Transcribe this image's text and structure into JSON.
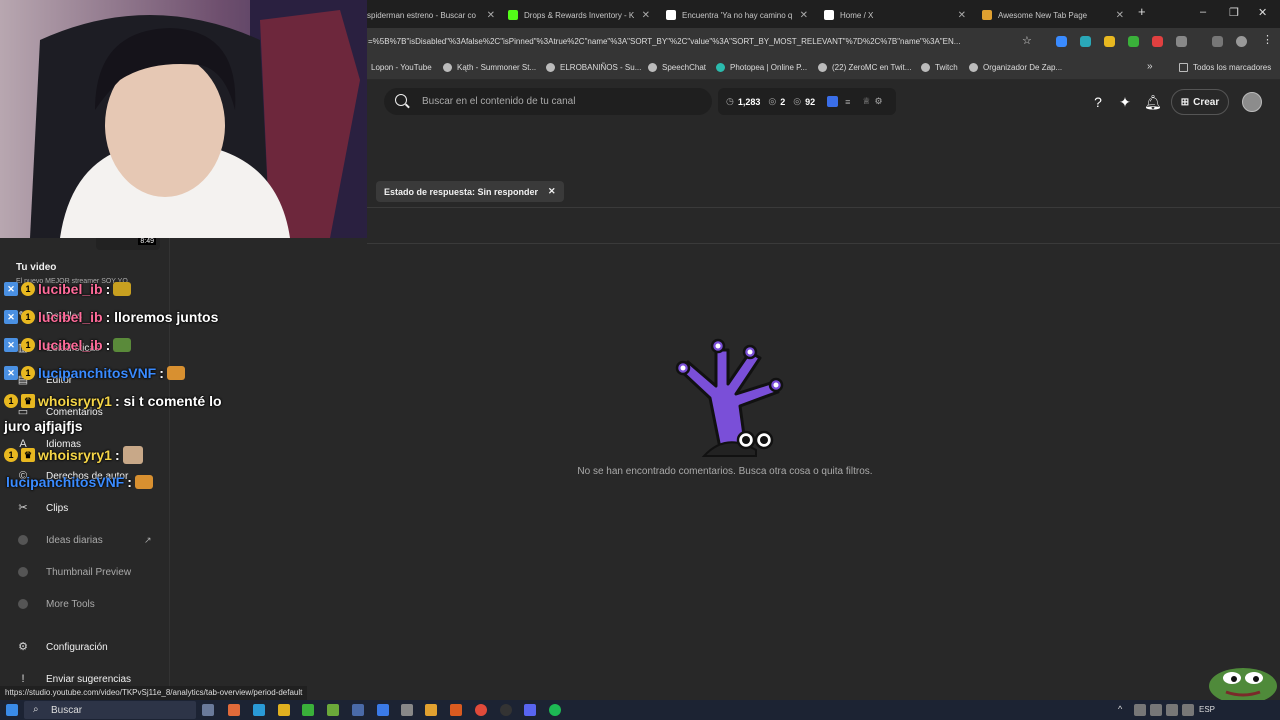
{
  "browser": {
    "tabs": [
      {
        "title": "spiderman estreno - Buscar co",
        "favicon_color": "#4285f4"
      },
      {
        "title": "Drops & Rewards Inventory - K",
        "favicon_color": "#53fc18"
      },
      {
        "title": "Encuentra 'Ya no hay camino q",
        "favicon_color": "#ffffff"
      },
      {
        "title": "Home / X",
        "favicon_color": "#ffffff"
      },
      {
        "title": "Awesome New Tab Page",
        "favicon_color": "#e0a030"
      }
    ],
    "new_tab": "+",
    "url": "=%5B%7B\"isDisabled\"%3Afalse%2C\"isPinned\"%3Atrue%2C\"name\"%3A\"SORT_BY\"%2C\"value\"%3A\"SORT_BY_MOST_RELEVANT\"%7D%2C%7B\"name\"%3A\"EN...",
    "bookmarks": [
      "Lopon - YouTube",
      "Kąth - Summoner St...",
      "ELROBANIÑOS - Su...",
      "SpeechChat",
      "Photopea | Online P...",
      "(22) ZeroMC en Twit...",
      "Twitch",
      "Organizador De Zap..."
    ],
    "bookmarks_more": "»",
    "all_bookmarks": "Todos los marcadores",
    "status_url": "https://studio.youtube.com/video/TKPvSj11e_8/analytics/tab-overview/period-default"
  },
  "header": {
    "search_placeholder": "Buscar en el contenido de tu canal",
    "stats": {
      "subs": "1,283",
      "views_a": "2",
      "views_b": "92"
    },
    "create_label": "Crear"
  },
  "filter": {
    "chip_label": "Estado de respuesta: Sin responder"
  },
  "empty_state": {
    "message": "No se han encontrado comentarios. Busca otra cosa o quita filtros."
  },
  "sidebar": {
    "video_badge": "8:49",
    "your_video": "Tu video",
    "video_title": "El nuevo MEJOR streamer SOY YO",
    "items": [
      "Detalles",
      "Estadísticas",
      "Editor",
      "Comentarios",
      "Idiomas",
      "Derechos de autor",
      "Clips"
    ],
    "extra_items": [
      "Ideas diarias",
      "Thumbnail Preview",
      "More Tools"
    ],
    "bottom_items": [
      "Configuración",
      "Enviar sugerencias"
    ]
  },
  "chat": [
    {
      "user": "lucibel_ib",
      "text": ":"
    },
    {
      "user": "lucibel_ib",
      "text": ": lloremos juntos"
    },
    {
      "user": "lucibel_ib",
      "text": ":"
    },
    {
      "user": "lucipanchitosVNF",
      "text": ":"
    },
    {
      "user": "whoisryry1",
      "text": ": si t comenté lo"
    },
    {
      "user": "",
      "text": "juro ajfjajfjs"
    },
    {
      "user": "whoisryry1",
      "text": ":"
    },
    {
      "user": "lucipanchitosVNF",
      "text": ":"
    }
  ],
  "taskbar": {
    "search_label": "Buscar",
    "lang": "ESP"
  }
}
